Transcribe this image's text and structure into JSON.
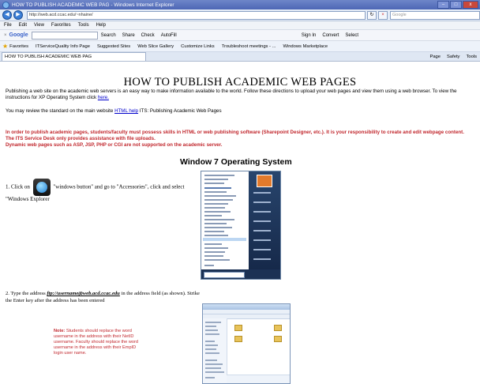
{
  "window": {
    "title": "HOW  TO PUBLISH ACADEMIC WEB PAG - Windows Internet Explorer",
    "buttons": [
      "–",
      "□",
      "x"
    ]
  },
  "address_bar": {
    "url": "http://web.acd.ccac.edu/~nhaine/",
    "search_placeholder": "Google"
  },
  "menu": [
    "File",
    "Edit",
    "View",
    "Favorites",
    "Tools",
    "Help"
  ],
  "google_toolbar": {
    "logo": "Google",
    "items": [
      "Search",
      "Share",
      "Check",
      "AutoFill",
      "Sign In",
      "Convert",
      "Select"
    ]
  },
  "favorites_bar": {
    "favorites_label": "Favorites",
    "links": [
      "ITServiceQuality Info Page",
      "Suggested Sites",
      "Web Slice Gallery",
      "Customize Links",
      "Troubleshoot meetings - ...",
      "Windows Marketplace"
    ]
  },
  "tab": {
    "label": "HOW  TO PUBLISH ACADEMIC WEB PAG",
    "tools": [
      "Page",
      "Safety",
      "Tools"
    ]
  },
  "page": {
    "heading": "HOW  TO PUBLISH ACADEMIC WEB PAGES",
    "intro": "Publishing a web site on the academic web servers is an easy way to make information available to the world. Follow these directions to upload your web pages and view them using a web browser. To view the instructions for XP Operating System click",
    "intro_link": "here.",
    "standard_prefix": "You may review the standard on the main website",
    "standard_link": "HTML help",
    "standard_suffix": "ITS: Publishing Academic Web Pages",
    "warning_lines": [
      "In order to publish academic pages, students/faculty must possess skills in HTML or web publishing software (Sharepoint Designer, etc.). It is your responsibility to create and edit webpage content.",
      "The ITS Service Desk only provides assistance with file uploads.",
      "Dynamic web pages such as ASP, JSP, PHP or CGI are not supported on the academic server."
    ],
    "os_heading": "Window  7 Operating System",
    "step1_prefix": "1. Click on",
    "step1_suffix": "\"windows button\" and go to \"Accessories\", click and select \"Windows Explorer",
    "step2_prefix": "2. Type the address",
    "step2_address": "ftp://username@web.acd.ccac.edu",
    "step2_suffix": "in the address field (as shown). Strike the Enter key after the address has been entered",
    "note_label": "Note:",
    "note_text": "Students should replace the word username in the address with their NetID username. Faculty should replace the word username in the address with their EmpID  login user name."
  }
}
